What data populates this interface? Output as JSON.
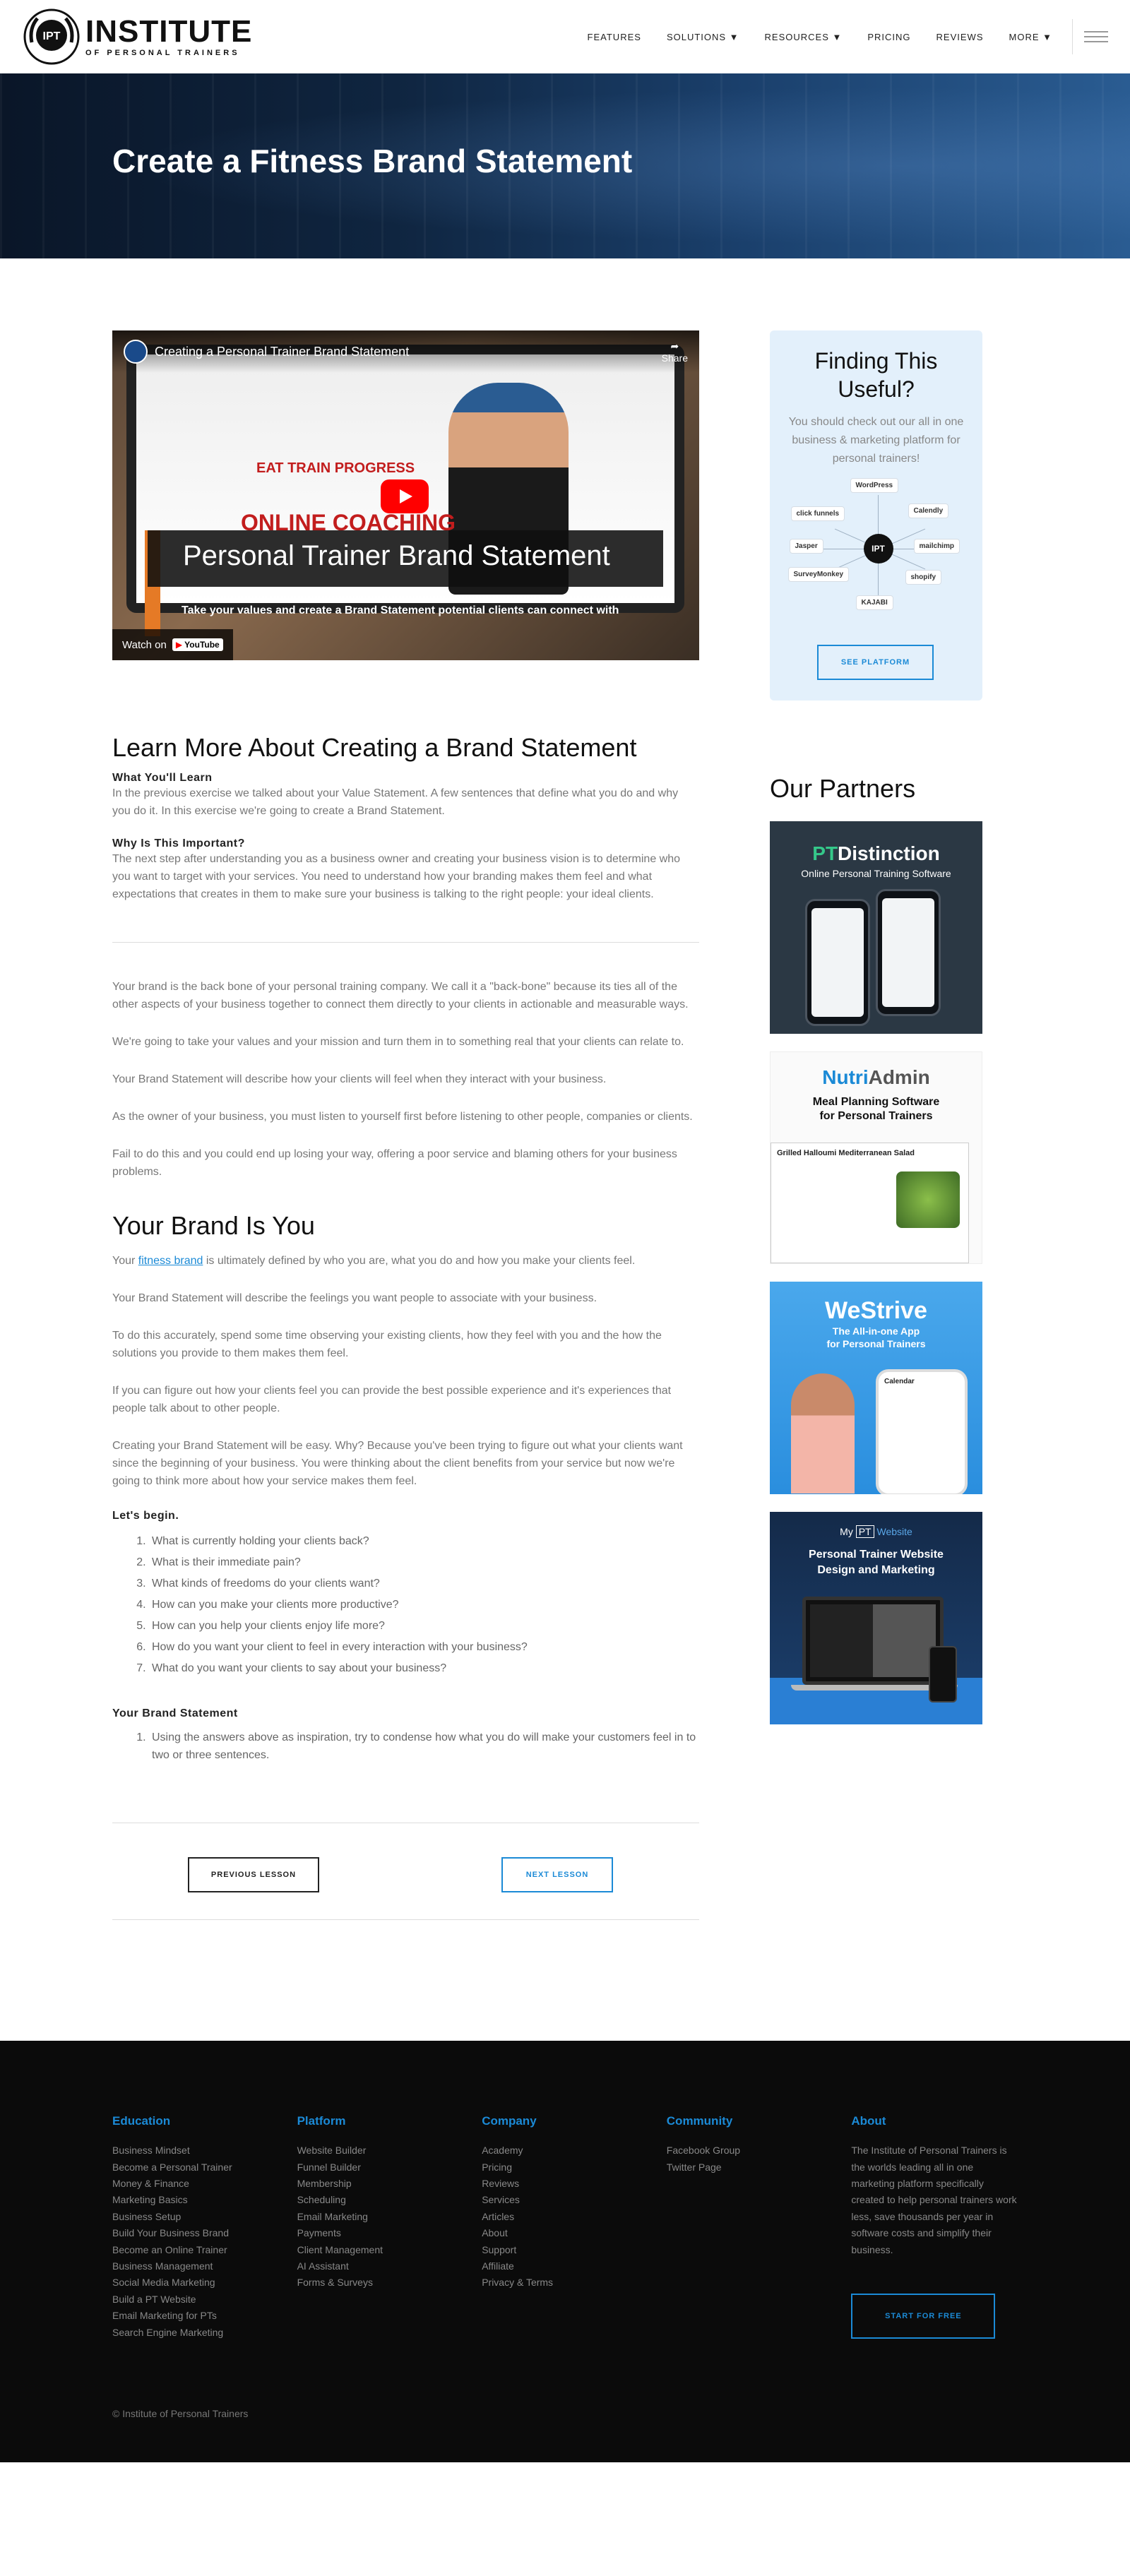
{
  "header": {
    "logo_badge": "IPT",
    "logo_title": "INSTITUTE",
    "logo_subtitle": "OF PERSONAL TRAINERS",
    "nav": [
      "FEATURES",
      "SOLUTIONS ▼",
      "RESOURCES ▼",
      "PRICING",
      "REVIEWS",
      "MORE ▼"
    ]
  },
  "hero": {
    "title": "Create a Fitness Brand Statement"
  },
  "video": {
    "title": "Creating a Personal Trainer Brand Statement",
    "share": "Share",
    "slide_brand": "EAT TRAIN PROGRESS",
    "slide_online": "ONLINE",
    "slide_coaching": "COACHING",
    "banner": "Personal Trainer Brand Statement",
    "subtitle": "Take your values and create a Brand Statement potential clients can connect with",
    "watch_on": "Watch on",
    "youtube": "YouTube"
  },
  "content": {
    "h2_learn": "Learn More About Creating a Brand Statement",
    "what_title": "What You'll Learn",
    "what_text": "In the previous exercise we talked about your Value Statement. A few sentences that define what you do and why you do it. In this exercise we're going to create a Brand Statement.",
    "why_title": "Why Is This Important?",
    "why_text": "The next step after understanding you as a business owner and creating your business vision is to determine who you want to target with your services. You need to understand how your branding makes them feel and what expectations that creates in them to make sure your business is talking to the right people: your ideal clients.",
    "p1": "Your brand is the back bone of your personal training company. We call it a \"back-bone\" because its ties all of the other aspects of your business together to connect them directly to your clients in actionable and measurable ways.",
    "p2": "We're going to take your values and your mission and turn them in to something real that your clients can relate to.",
    "p3": "Your Brand Statement will describe how your clients will feel when they interact with your business.",
    "p4": "As the owner of your business, you must listen to yourself first before listening to other people, companies or clients.",
    "p5": "Fail to do this and you could end up losing your way, offering a poor service and blaming others for your business problems.",
    "h2_brand": "Your Brand Is You",
    "b1_pre": "Your ",
    "b1_link": "fitness brand",
    "b1_post": " is ultimately defined by who you are, what you do and how you make your clients feel.",
    "b2": "Your Brand Statement will describe the feelings you want people to associate with your business.",
    "b3": "To do this accurately, spend some time observing your existing clients, how they feel with you and the how the solutions you provide to them makes them feel.",
    "b4": "If you can figure out how your clients feel you can provide the best possible experience and it's experiences that people talk about to other people.",
    "b5": "Creating your Brand Statement will be easy. Why? Because you've been trying to figure out what your clients want since the beginning of your business. You were thinking about the client benefits from your service but now we're going to think more about how your service makes them feel.",
    "lets_begin": "Let's begin.",
    "questions": [
      "What is currently holding your clients back?",
      "What is their immediate pain?",
      "What kinds of freedoms do your clients want?",
      "How can you make your clients more productive?",
      "How can you help your clients enjoy life more?",
      "How do you want your client to feel in every interaction with your business?",
      "What do you want your clients to say about your business?"
    ],
    "statement_title": "Your Brand Statement",
    "statement_items": [
      "Using the answers above as inspiration, try to condense how what you do will make your customers feel in to two or three sentences."
    ],
    "prev_btn": "PREVIOUS LESSON",
    "next_btn": "NEXT LESSON"
  },
  "sidebar": {
    "finding_title_1": "Finding This",
    "finding_title_2": "Useful?",
    "finding_text": "You should check out our all in one business & marketing platform for personal trainers!",
    "hub_center": "IPT",
    "hub_nodes": [
      "WordPress",
      "Calendly",
      "mailchimp",
      "shopify",
      "KAJABI",
      "SurveyMonkey",
      "Jasper",
      "click funnels"
    ],
    "see_btn": "SEE PLATFORM",
    "partners_title": "Our Partners",
    "p1_title_a": "PT",
    "p1_title_b": "Distinction",
    "p1_sub": "Online Personal Training Software",
    "p2_title_a": "Nutri",
    "p2_title_b": "Admin",
    "p2_sub_1": "Meal Planning Software",
    "p2_sub_2": "for Personal Trainers",
    "p2_card": "Grilled Halloumi Mediterranean Salad",
    "p3_title": "WeStrive",
    "p3_sub_1": "The All-in-one App",
    "p3_sub_2": "for Personal Trainers",
    "p3_app": "Calendar",
    "p4_top_a": "My",
    "p4_top_b": "PT",
    "p4_top_c": "Website",
    "p4_sub_1": "Personal Trainer Website",
    "p4_sub_2": "Design and Marketing"
  },
  "footer": {
    "education_title": "Education",
    "education": [
      "Business Mindset",
      "Become a Personal Trainer",
      "Money & Finance",
      "Marketing Basics",
      "Business Setup",
      "Build Your Business Brand",
      "Become an Online Trainer",
      "Business Management",
      "Social Media Marketing",
      "Build a PT Website",
      "Email Marketing for PTs",
      "Search Engine Marketing"
    ],
    "platform_title": "Platform",
    "platform": [
      "Website Builder",
      "Funnel Builder",
      "Membership",
      "Scheduling",
      "Email Marketing",
      "Payments",
      "Client Management",
      "AI Assistant",
      "Forms & Surveys"
    ],
    "company_title": "Company",
    "company": [
      "Academy",
      "Pricing",
      "Reviews",
      "Services",
      "Articles",
      "About",
      "Support",
      "Affiliate",
      "Privacy & Terms"
    ],
    "community_title": "Community",
    "community": [
      "Facebook Group",
      "Twitter Page"
    ],
    "about_title": "About",
    "about_text": "The Institute of Personal Trainers is the worlds leading all in one marketing platform specifically created to help personal trainers work less, save thousands per year in software costs and simplify their business.",
    "start_btn": "START FOR FREE",
    "copyright": "© Institute of Personal Trainers"
  },
  "colors": {
    "accent": "#1b8ad6",
    "orange": "#e57a26",
    "footer_bg": "#0b0b0b",
    "sidebar_card": "#e3f0fb"
  }
}
